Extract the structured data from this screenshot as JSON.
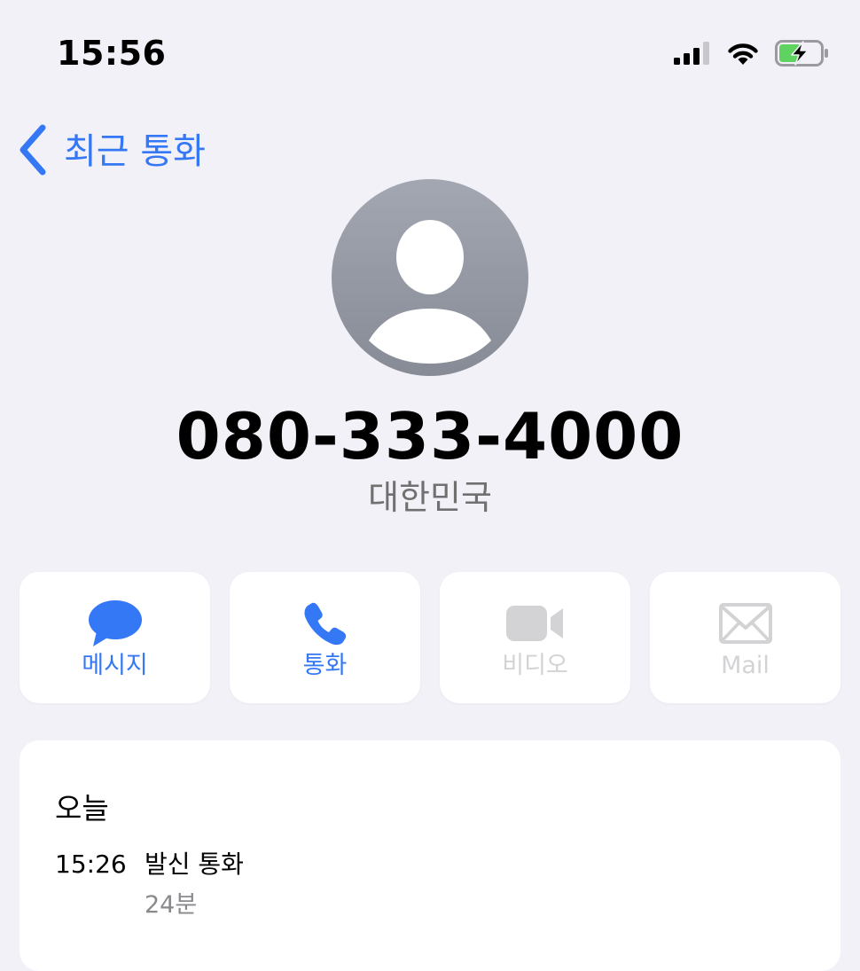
{
  "status_bar": {
    "time": "15:56",
    "icons": [
      "cellular-signal-icon",
      "wifi-icon",
      "battery-charging-icon"
    ]
  },
  "nav": {
    "back_label": "최근 통화",
    "back_icon": "chevron-left-icon"
  },
  "contact": {
    "avatar_icon": "person-placeholder-icon",
    "phone_number": "080-333-4000",
    "country": "대한민국"
  },
  "actions": [
    {
      "label": "메시지",
      "icon": "message-bubble-icon",
      "enabled": true
    },
    {
      "label": "통화",
      "icon": "phone-icon",
      "enabled": true
    },
    {
      "label": "비디오",
      "icon": "video-camera-icon",
      "enabled": false
    },
    {
      "label": "Mail",
      "icon": "envelope-icon",
      "enabled": false
    }
  ],
  "call_log": {
    "date_header": "오늘",
    "entries": [
      {
        "time": "15:26",
        "type": "발신 통화",
        "duration": "24분"
      }
    ]
  },
  "colors": {
    "accent": "#3478f6",
    "background": "#f2f1f7",
    "card": "#ffffff",
    "disabled": "#d3d3d6",
    "secondary_text": "#707070",
    "battery_fill": "#5fd35f"
  }
}
